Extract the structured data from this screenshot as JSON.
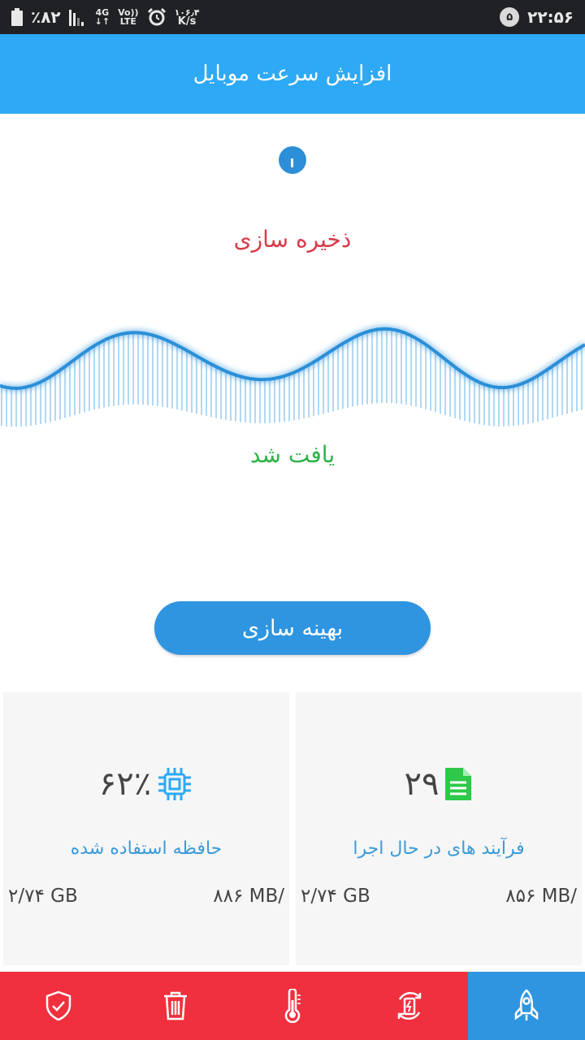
{
  "status_bar": {
    "battery": "٪۸۲",
    "network_top": "4G",
    "network_bottom": "LTE",
    "volte_top": "Vo))",
    "speed_top": "۱۰۶٫۴",
    "speed_bottom": "K/s",
    "notification_count": "۵",
    "time": "۲۲:۵۶"
  },
  "app_bar": {
    "title": "افزایش سرعت موبایل"
  },
  "scan": {
    "saving_label": "ذخیره سازی",
    "found_label": "یافت شد",
    "colors": {
      "saving": "#d73a4a",
      "found": "#2fb34a"
    }
  },
  "optimize_button": {
    "label": "بهینه سازی"
  },
  "cards": {
    "memory": {
      "value": "۶۲٪",
      "label": "حافظه استفاده شده",
      "used": "۸۸۶ MB/",
      "total": "۲/۷۴ GB",
      "icon": "chip-icon"
    },
    "processes": {
      "value": "۲۹",
      "label": "فرآیند های در حال اجرا",
      "used": "۸۵۶ MB/",
      "total": "۲/۷۴ GB",
      "icon": "document-icon"
    }
  },
  "bottom_nav": {
    "items": [
      "shield-check-icon",
      "trash-icon",
      "thermometer-icon",
      "battery-charge-icon",
      "rocket-icon"
    ],
    "active": "rocket-icon",
    "colors": {
      "bar": "#f0303e",
      "active": "#2f95e0"
    }
  },
  "colors": {
    "app_bar": "#2ea9f5",
    "accent": "#2f95e0"
  }
}
